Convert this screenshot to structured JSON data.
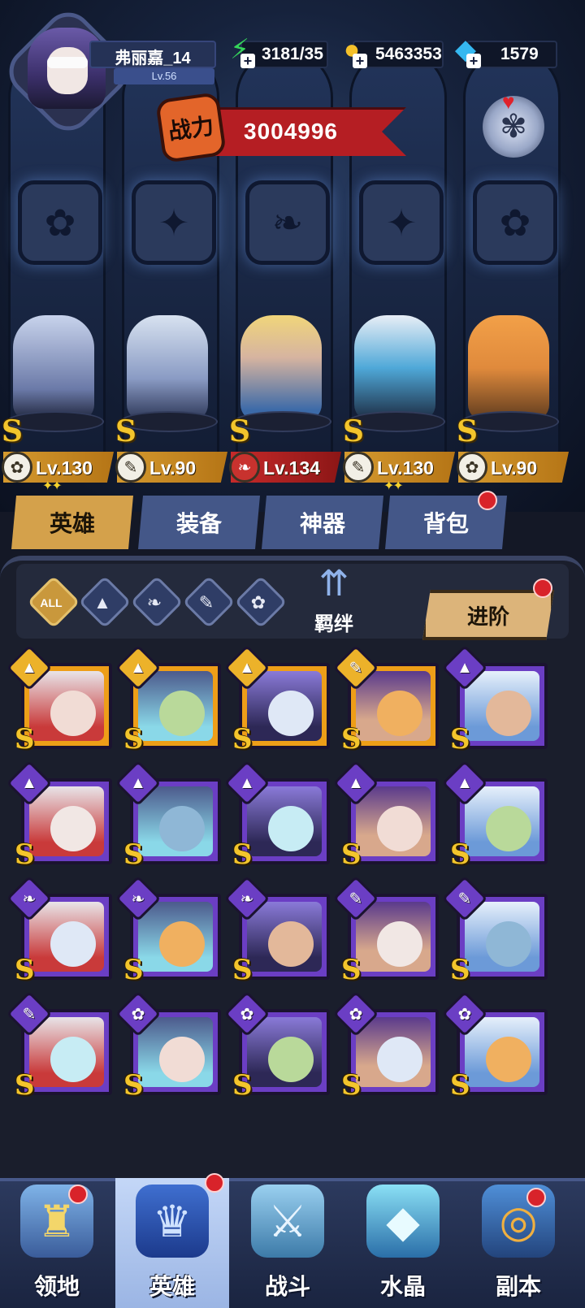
{
  "player": {
    "name": "弗丽嘉_14",
    "level": "Lv.56"
  },
  "resources": {
    "stamina": "3181/35",
    "gold": "5463353",
    "diamond": "1579"
  },
  "power": {
    "label": "战力",
    "value": "3004996"
  },
  "team": [
    {
      "level": "Lv.130",
      "rank": "S",
      "class_icon": "beast-icon",
      "bar": "gold",
      "stars": "✦✦"
    },
    {
      "level": "Lv.90",
      "rank": "S",
      "class_icon": "wrench-icon",
      "bar": "gold",
      "stars": ""
    },
    {
      "level": "Lv.134",
      "rank": "S",
      "class_icon": "wing-icon",
      "bar": "red",
      "stars": ""
    },
    {
      "level": "Lv.130",
      "rank": "S",
      "class_icon": "wrench-icon",
      "bar": "gold",
      "stars": "✦✦"
    },
    {
      "level": "Lv.90",
      "rank": "S",
      "class_icon": "beast-icon",
      "bar": "gold",
      "stars": ""
    }
  ],
  "tabs": [
    {
      "label": "英雄",
      "active": true
    },
    {
      "label": "装备",
      "active": false
    },
    {
      "label": "神器",
      "active": false
    },
    {
      "label": "背包",
      "active": false
    }
  ],
  "filters": {
    "all_label": "ALL"
  },
  "bond": {
    "label": "羁绊"
  },
  "advance": {
    "label": "进阶"
  },
  "heroes": [
    {
      "rank": "S",
      "frame": "gold",
      "class": "flask"
    },
    {
      "rank": "S",
      "frame": "gold",
      "class": "flask"
    },
    {
      "rank": "S",
      "frame": "gold",
      "class": "flask"
    },
    {
      "rank": "S",
      "frame": "gold",
      "class": "wrench"
    },
    {
      "rank": "S",
      "frame": "purple",
      "class": "flask"
    },
    {
      "rank": "S",
      "frame": "purple",
      "class": "flask"
    },
    {
      "rank": "S",
      "frame": "purple",
      "class": "flask"
    },
    {
      "rank": "S",
      "frame": "purple",
      "class": "flask"
    },
    {
      "rank": "S",
      "frame": "purple",
      "class": "flask"
    },
    {
      "rank": "S",
      "frame": "purple",
      "class": "flask"
    },
    {
      "rank": "S",
      "frame": "purple",
      "class": "wing"
    },
    {
      "rank": "S",
      "frame": "purple",
      "class": "wing"
    },
    {
      "rank": "S",
      "frame": "purple",
      "class": "wing"
    },
    {
      "rank": "S",
      "frame": "purple",
      "class": "wrench"
    },
    {
      "rank": "S",
      "frame": "purple",
      "class": "wrench"
    },
    {
      "rank": "S",
      "frame": "purple",
      "class": "wrench"
    },
    {
      "rank": "S",
      "frame": "purple",
      "class": "beast"
    },
    {
      "rank": "S",
      "frame": "purple",
      "class": "beast"
    },
    {
      "rank": "S",
      "frame": "purple",
      "class": "beast"
    },
    {
      "rank": "S",
      "frame": "purple",
      "class": "beast"
    }
  ],
  "nav": [
    {
      "label": "领地",
      "icon": "castle-icon",
      "active": false
    },
    {
      "label": "英雄",
      "icon": "hero-hat-icon",
      "active": true
    },
    {
      "label": "战斗",
      "icon": "battle-icon",
      "active": false
    },
    {
      "label": "水晶",
      "icon": "crystal-icon",
      "active": false
    },
    {
      "label": "副本",
      "icon": "dungeon-icon",
      "active": false
    }
  ],
  "colors": {
    "gold": "#ee9e18",
    "purple": "#6b3ec4",
    "accent_red": "#b51e23",
    "tab_active": "#d4a14b"
  }
}
